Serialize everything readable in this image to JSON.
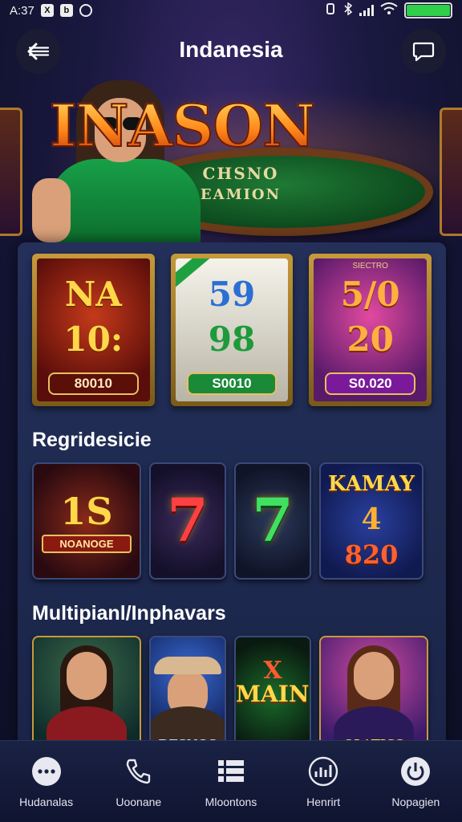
{
  "status_bar": {
    "time": "A:37",
    "battery_label": "",
    "battery_level": 1.0
  },
  "header": {
    "title": "Indanesia",
    "back_icon": "arrow-left-icon",
    "chat_icon": "chat-bubble-icon"
  },
  "hero": {
    "logo_text": "INASON",
    "table_line1": "CHSNO",
    "table_line2": "EAMION"
  },
  "featured": [
    {
      "top": "",
      "line1": "NA",
      "line2": "10:",
      "badge": "80010"
    },
    {
      "top": "",
      "line1": "59",
      "line2": "98",
      "badge": "S0010"
    },
    {
      "top": "SIECTRO",
      "line1": "5/0",
      "line2": "20",
      "badge": "S0.020"
    }
  ],
  "section1": {
    "title": "Regridesicie",
    "tiles": [
      {
        "big": "1S",
        "small": "NOANOGE"
      },
      {
        "big": "7"
      },
      {
        "big": "7"
      },
      {
        "line1": "KAMAY",
        "line2": "4",
        "line3": "820"
      }
    ]
  },
  "section2": {
    "title": "Multipianl/Inphavars",
    "tiles": [
      {
        "label": ""
      },
      {
        "label": "DESNOS"
      },
      {
        "top": "X",
        "big": "MAINS"
      },
      {
        "label": "OLATICS"
      }
    ]
  },
  "bottom_nav": [
    {
      "icon": "more-dots-icon",
      "label": "Hudanalas"
    },
    {
      "icon": "phone-icon",
      "label": "Uoonane"
    },
    {
      "icon": "list-icon",
      "label": "Mloontons"
    },
    {
      "icon": "chart-icon",
      "label": "Henrirt"
    },
    {
      "icon": "power-icon",
      "label": "Nopagien"
    }
  ]
}
